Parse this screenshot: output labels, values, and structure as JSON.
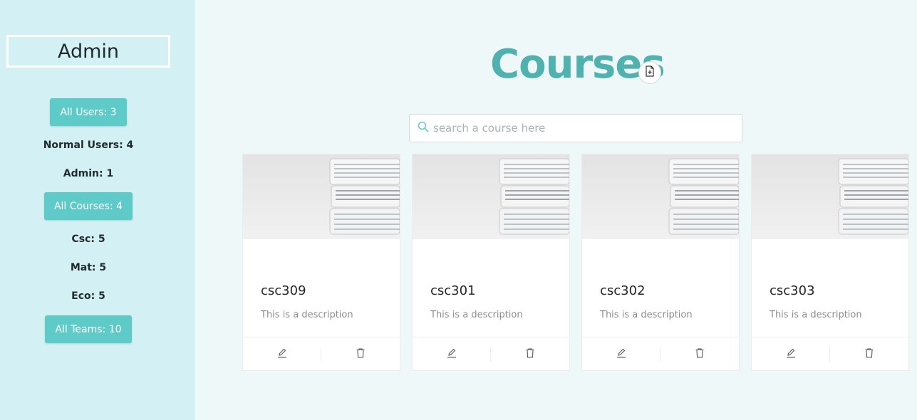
{
  "sidebar": {
    "title": "Admin",
    "all_users": "All Users: 3",
    "normal_users": "Normal Users: 4",
    "admin_count": "Admin: 1",
    "all_courses": "All Courses: 4",
    "csc": "Csc: 5",
    "mat": "Mat: 5",
    "eco": "Eco: 5",
    "all_teams": "All Teams: 10"
  },
  "main": {
    "title": "Courses",
    "search": {
      "placeholder": "search a course here",
      "value": ""
    },
    "cards": [
      {
        "title": "csc309",
        "description": "This is a description"
      },
      {
        "title": "csc301",
        "description": "This is a description"
      },
      {
        "title": "csc302",
        "description": "This is a description"
      },
      {
        "title": "csc303",
        "description": "This is a description"
      }
    ]
  },
  "icons": {
    "add_course": "file-add-icon",
    "search": "search-icon",
    "edit": "edit-icon",
    "delete": "delete-icon"
  },
  "colors": {
    "sidebar_bg": "#d3f1f4",
    "accent": "#5ecbc9",
    "title": "#4fb2ae",
    "page_bg": "#eff8f9"
  }
}
